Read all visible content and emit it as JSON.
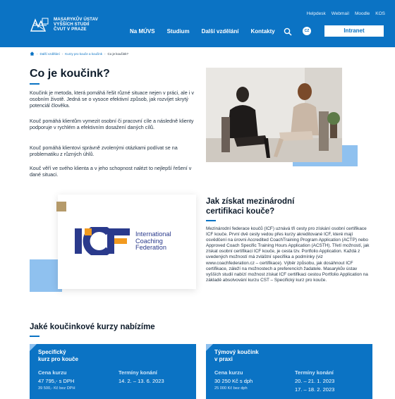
{
  "header": {
    "logo_lines": [
      "MASARYKŮV ÚSTAV",
      "VYŠŠÍCH STUDIÍ",
      "ČVUT V PRAZE"
    ],
    "util_links": [
      "Helpdesk",
      "Webmail",
      "Moodle",
      "KOS"
    ],
    "nav": [
      "Na MÚVS",
      "Studium",
      "Další vzdělání",
      "Kontakty"
    ],
    "lang": "CZ",
    "intranet": "Intranet",
    "accent": "#0b73c4"
  },
  "breadcrumb": {
    "items": [
      "Další vzdělání",
      "Kurzy pro kouče a koučink"
    ],
    "current": "Co je koučink?"
  },
  "intro": {
    "title": "Co je koučink?",
    "paragraphs": [
      "Koučink je metoda, která pomáhá řešit různé situace nejen v práci, ale i v osobním životě. Jedná se o vysoce efektivní způsob, jak rozvíjet skrytý potenciál člověka.",
      "Kouč pomáhá klientům vymezit osobní či pracovní cíle a následně klienty podporuje v rychlém a efektivním dosažení daných cílů.",
      "Kouč pomáhá klientovi správně zvolenými otázkami podívat se na problematiku z různých úhlů.",
      "Kouč věří ve svého klienta a v jeho schopnost nalézt to nejlepší řešení v dané situaci."
    ]
  },
  "icf": {
    "lines": [
      "International",
      "Coaching",
      "Federation"
    ]
  },
  "certification": {
    "title_lines": [
      "Jak získat mezinárodní",
      "certifikaci kouče?"
    ],
    "text": "Mezinárodní federace koučů (ICF) uznává tři cesty pro získání osobní certifikace ICF kouče. První dvě cesty vedou přes kurzy akreditované ICF, které mají osvědčení na úrovni Accredited CoachTraining Program Application (ACTP) nebo Approved Coach Specific Training Hours Application (ACSTH). Třetí možností, jak získat osobní certifikaci ICF kouče, je cesta tzv. Portfolio Application. Každá z uvedených možností má zvláštní specifika a podmínky (viz www.coachfederation.cz – certifikace). Výběr způsobu, jak dosáhnout ICF certifikace, záleží na možnostech a preferencích žadatele. Masarykův ústav vyšších studií nabízí možnost získat ICF certifikaci cestou Portfolio Application na základě absolvování kurzu CST – Specifický kurz pro kouče."
  },
  "courses": {
    "title": "Jaké koučinkové kurzy nabízíme",
    "cards": [
      {
        "name_lines": [
          "Specifický",
          "kurz pro kouče"
        ],
        "price_label": "Cena kurzu",
        "price": "47 795,- s DPH",
        "price_sub": "39 500,- Kč bez DPH",
        "dates_label": "Termíny konání",
        "dates": [
          "14. 2. – 13. 6. 2023"
        ]
      },
      {
        "name_lines": [
          "Týmový koučink",
          "v praxi"
        ],
        "price_label": "Cena kurzu",
        "price": "30 250 Kč s dph",
        "price_sub": "25 000 Kč bez dph",
        "dates_label": "Termíny konání",
        "dates": [
          "20. – 21. 1. 2023",
          "17. – 18. 2. 2023"
        ]
      }
    ]
  }
}
